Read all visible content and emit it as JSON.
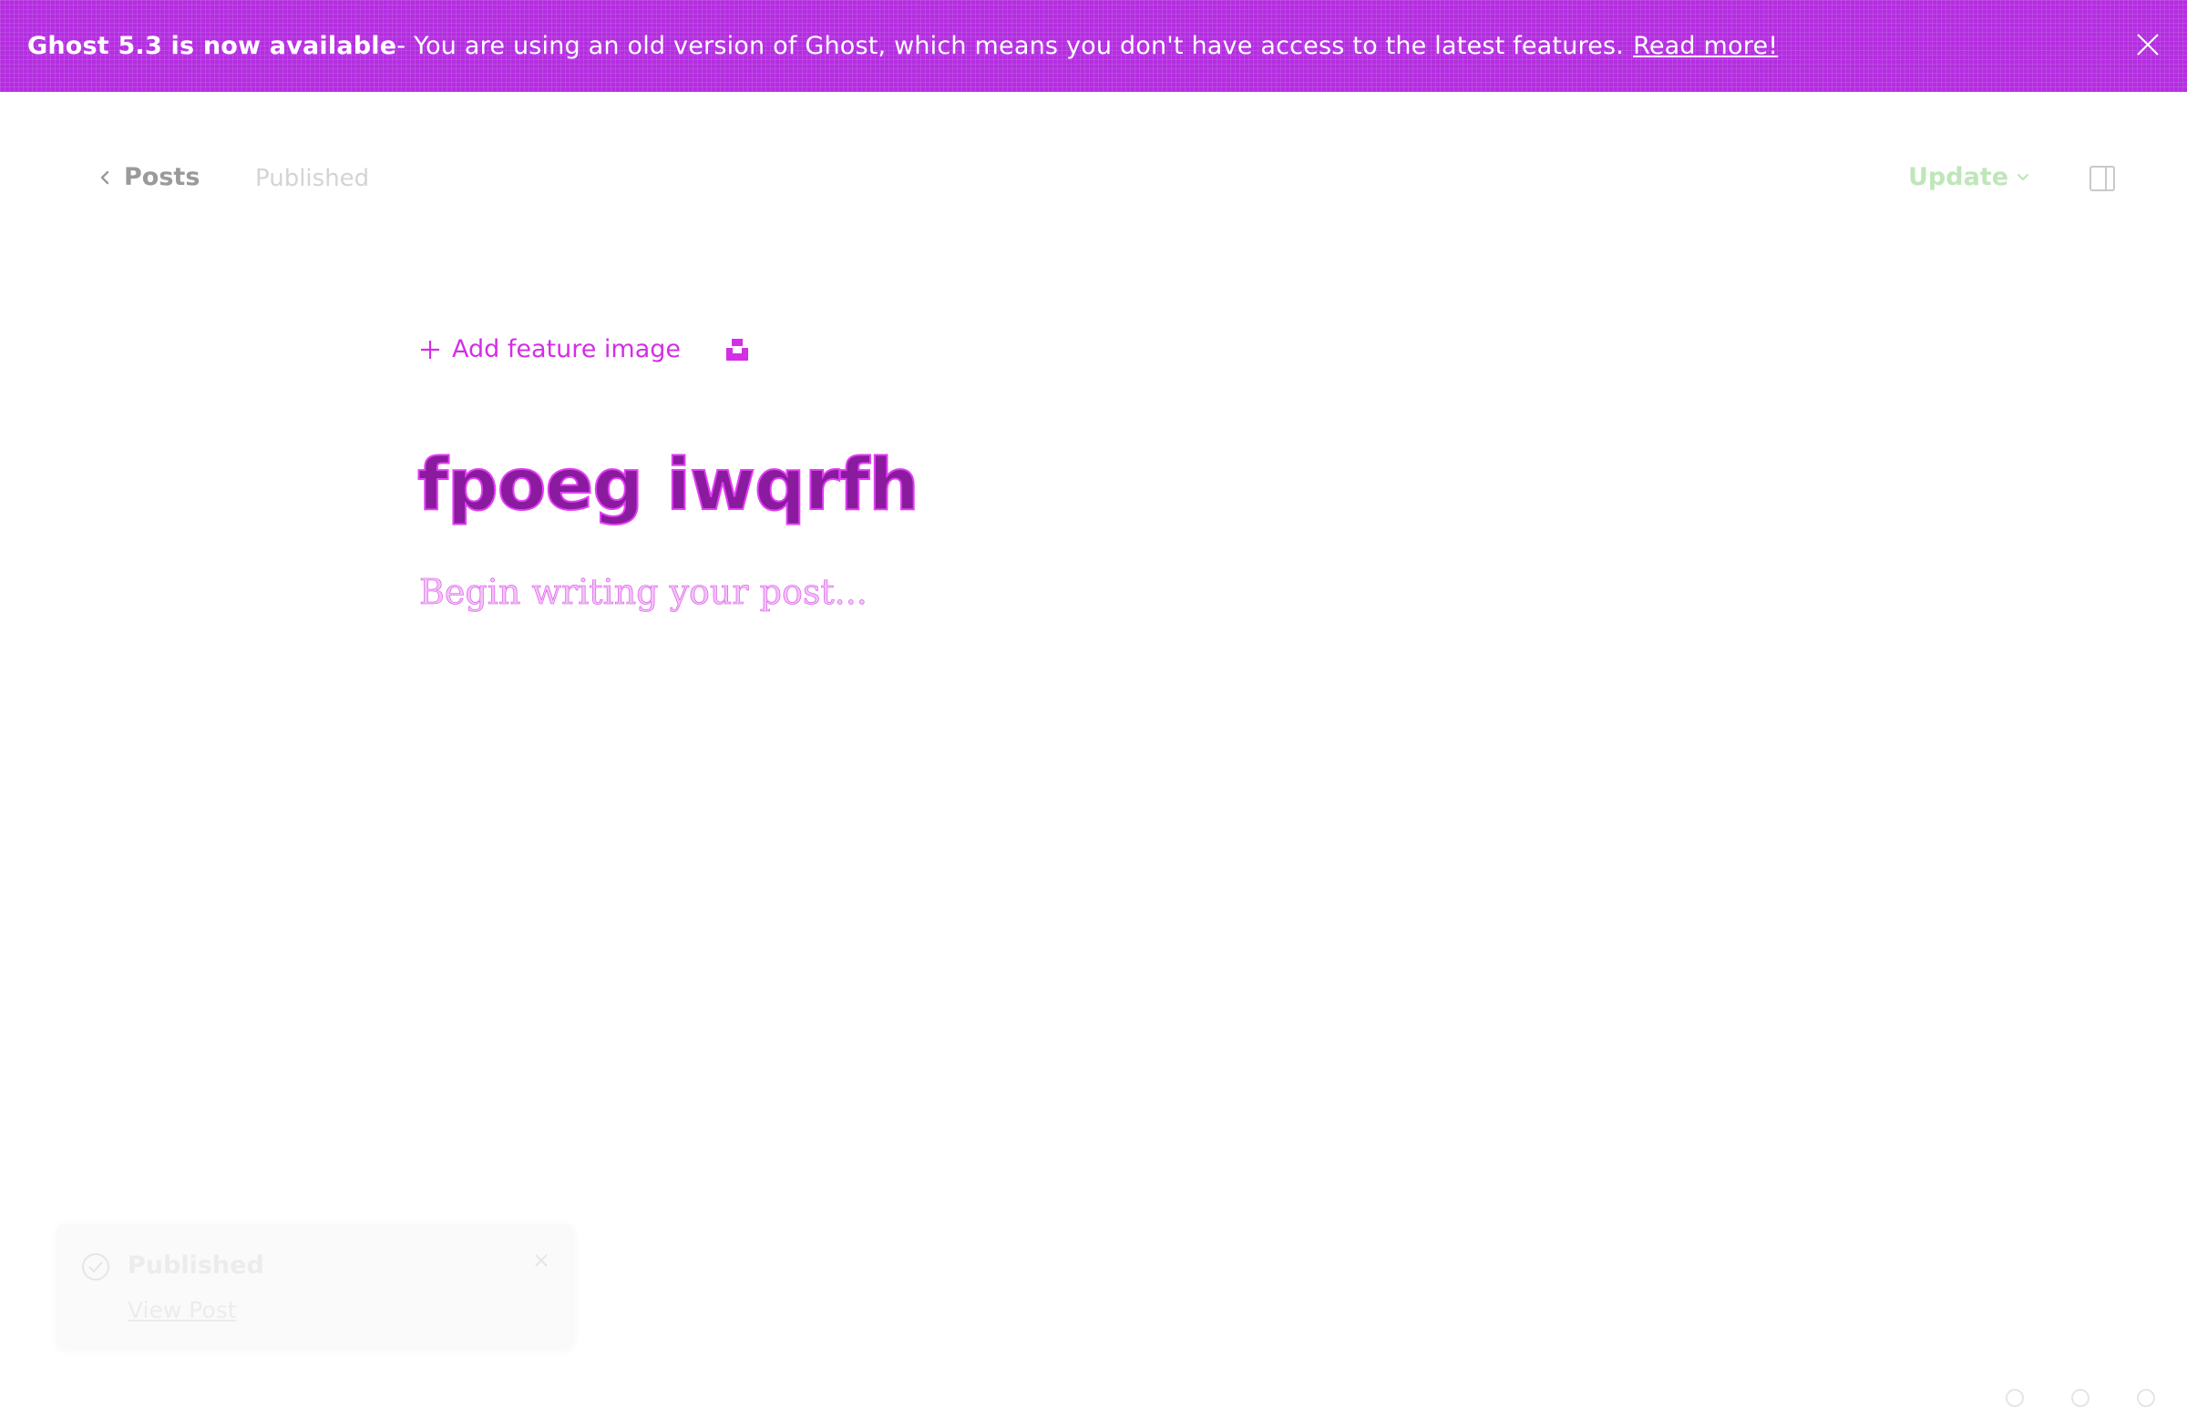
{
  "banner": {
    "strong": "Ghost 5.3 is now available",
    "text": " - You are using an old version of Ghost, which means you don't have access to the latest features.",
    "link": "Read more!",
    "close_icon": "close-icon",
    "color": "#b42ee0"
  },
  "header": {
    "back_label": "Posts",
    "status": "Published",
    "update_label": "Update",
    "update_color": "#bfe6b9",
    "sidebar_icon": "sidebar-panel-icon"
  },
  "editor": {
    "add_feature_label": "Add feature image",
    "unsplash_icon": "unsplash-icon",
    "title": "fpoeg iwqrfh",
    "body_placeholder": "Begin writing your post..."
  },
  "toast": {
    "title": "Published",
    "link": "View Post"
  }
}
